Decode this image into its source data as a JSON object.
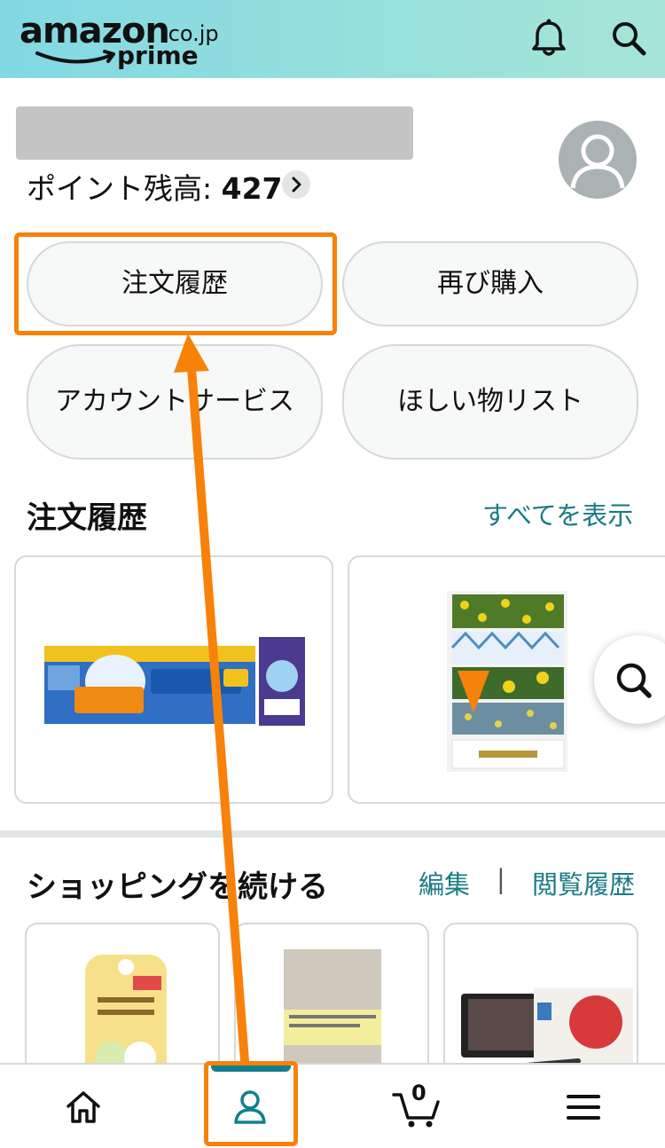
{
  "header": {
    "logo_main": "amazon",
    "logo_suffix": ".co.jp",
    "logo_sub": "prime",
    "icons": [
      "bell-icon",
      "search-icon"
    ],
    "gradient_start": "#82d8e3",
    "gradient_end": "#a6e5d6"
  },
  "account": {
    "points_label": "ポイント残高: ",
    "points_value": "427",
    "avatar_icon": "user-icon"
  },
  "quick_actions": [
    {
      "label": "注文履歴"
    },
    {
      "label": "再び購入"
    },
    {
      "label": "アカウントサービス"
    },
    {
      "label": "ほしい物リスト"
    }
  ],
  "orders": {
    "title": "注文履歴",
    "see_all": "すべてを表示"
  },
  "shopping": {
    "title": "ショッピングを続ける",
    "edit": "編集",
    "separator": "|",
    "history": "閲覧履歴"
  },
  "bottom_nav": {
    "items": [
      "home-icon",
      "account-icon",
      "cart-icon",
      "menu-icon"
    ],
    "cart_count": "0",
    "active": "account",
    "active_color": "#137f8c"
  },
  "annotation": {
    "color": "#f7820a"
  },
  "colors": {
    "link": "#1a7b85",
    "pill_bg": "#f7f8f8",
    "border": "#d5d9d9"
  }
}
